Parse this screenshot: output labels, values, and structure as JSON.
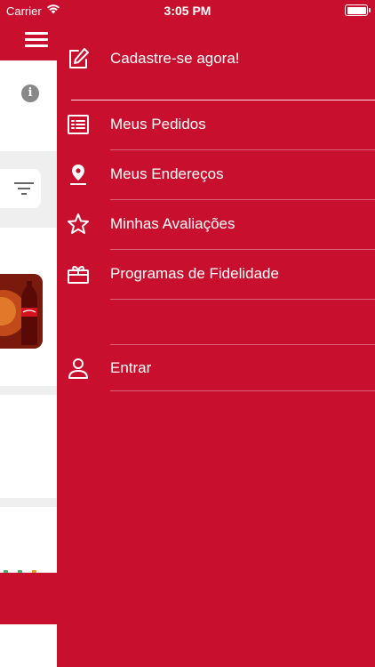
{
  "status_bar": {
    "carrier": "Carrier",
    "time": "3:05 PM",
    "wifi_icon": "wifi-icon",
    "battery_icon": "battery-icon"
  },
  "colors": {
    "primary_red": "#c8102e",
    "white": "#ffffff",
    "light_grey": "#efefef"
  },
  "menu": {
    "items": [
      {
        "label": "Cadastre-se agora!",
        "icon": "edit-icon"
      },
      {
        "label": "Meus Pedidos",
        "icon": "list-icon"
      },
      {
        "label": "Meus Endereços",
        "icon": "location-pin-icon"
      },
      {
        "label": "Minhas Avaliações",
        "icon": "star-icon"
      },
      {
        "label": "Programas de Fidelidade",
        "icon": "gift-icon"
      },
      {
        "label": "Entrar",
        "icon": "user-icon"
      }
    ]
  },
  "background_page": {
    "menu_icon": "hamburger-icon",
    "info_icon": "info-icon",
    "filter_icon": "filter-icon",
    "product_image": "product-thumbnail"
  }
}
